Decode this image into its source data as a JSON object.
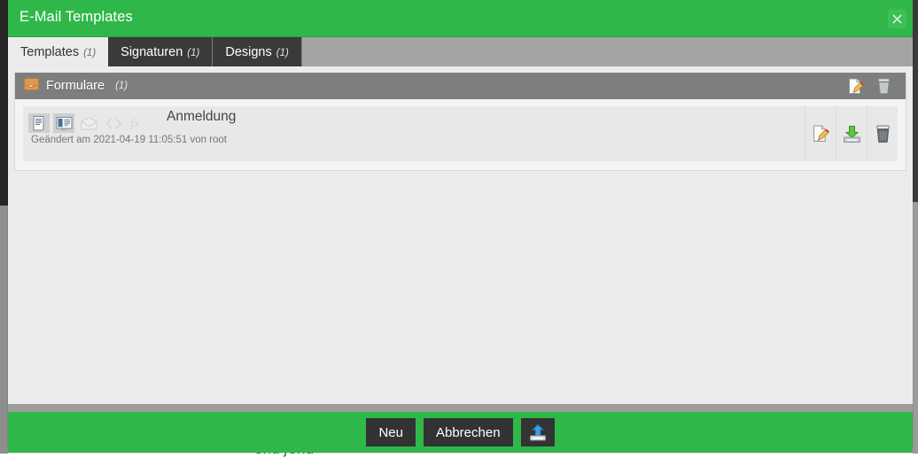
{
  "window": {
    "title": "E-Mail Templates",
    "close_icon": "close-icon",
    "accent_color": "#2fb849",
    "titlebar_text_color": "#ffffff"
  },
  "tabs": [
    {
      "label": "Templates",
      "count": "(1)",
      "active": true
    },
    {
      "label": "Signaturen",
      "count": "(1)",
      "active": false
    },
    {
      "label": "Designs",
      "count": "(1)",
      "active": false
    }
  ],
  "group": {
    "icon": "inbox-tray-icon",
    "title": "Formulare",
    "count": "(1)",
    "header_color": "#7e7e7e",
    "actions": [
      {
        "name": "new-template-icon",
        "label": "Neu"
      },
      {
        "name": "delete-group-icon",
        "label": "Löschen"
      }
    ]
  },
  "list": {
    "items": [
      {
        "title": "Anmeldung",
        "subtitle": "Geändert am 2021-04-19 11:05:51 von root",
        "type_icons": [
          {
            "name": "text-document-icon",
            "state": "selected"
          },
          {
            "name": "html-preview-icon",
            "state": "selected"
          },
          {
            "name": "envelope-icon",
            "state": "disabled"
          },
          {
            "name": "code-brackets-icon",
            "state": "disabled"
          },
          {
            "name": "function-fx-icon",
            "state": "disabled"
          }
        ],
        "actions": [
          {
            "name": "edit-template-icon",
            "label": "Bearbeiten"
          },
          {
            "name": "download-template-icon",
            "label": "Herunterladen"
          },
          {
            "name": "delete-template-icon",
            "label": "Löschen"
          }
        ]
      }
    ]
  },
  "footer": {
    "buttons": [
      {
        "name": "new-button",
        "label": "Neu",
        "kind": "text"
      },
      {
        "name": "cancel-button",
        "label": "Abbrechen",
        "kind": "text"
      },
      {
        "name": "upload-button",
        "label": "",
        "kind": "icon",
        "icon": "upload-icon"
      }
    ]
  },
  "background": {
    "code_snippet": "end'}end"
  }
}
